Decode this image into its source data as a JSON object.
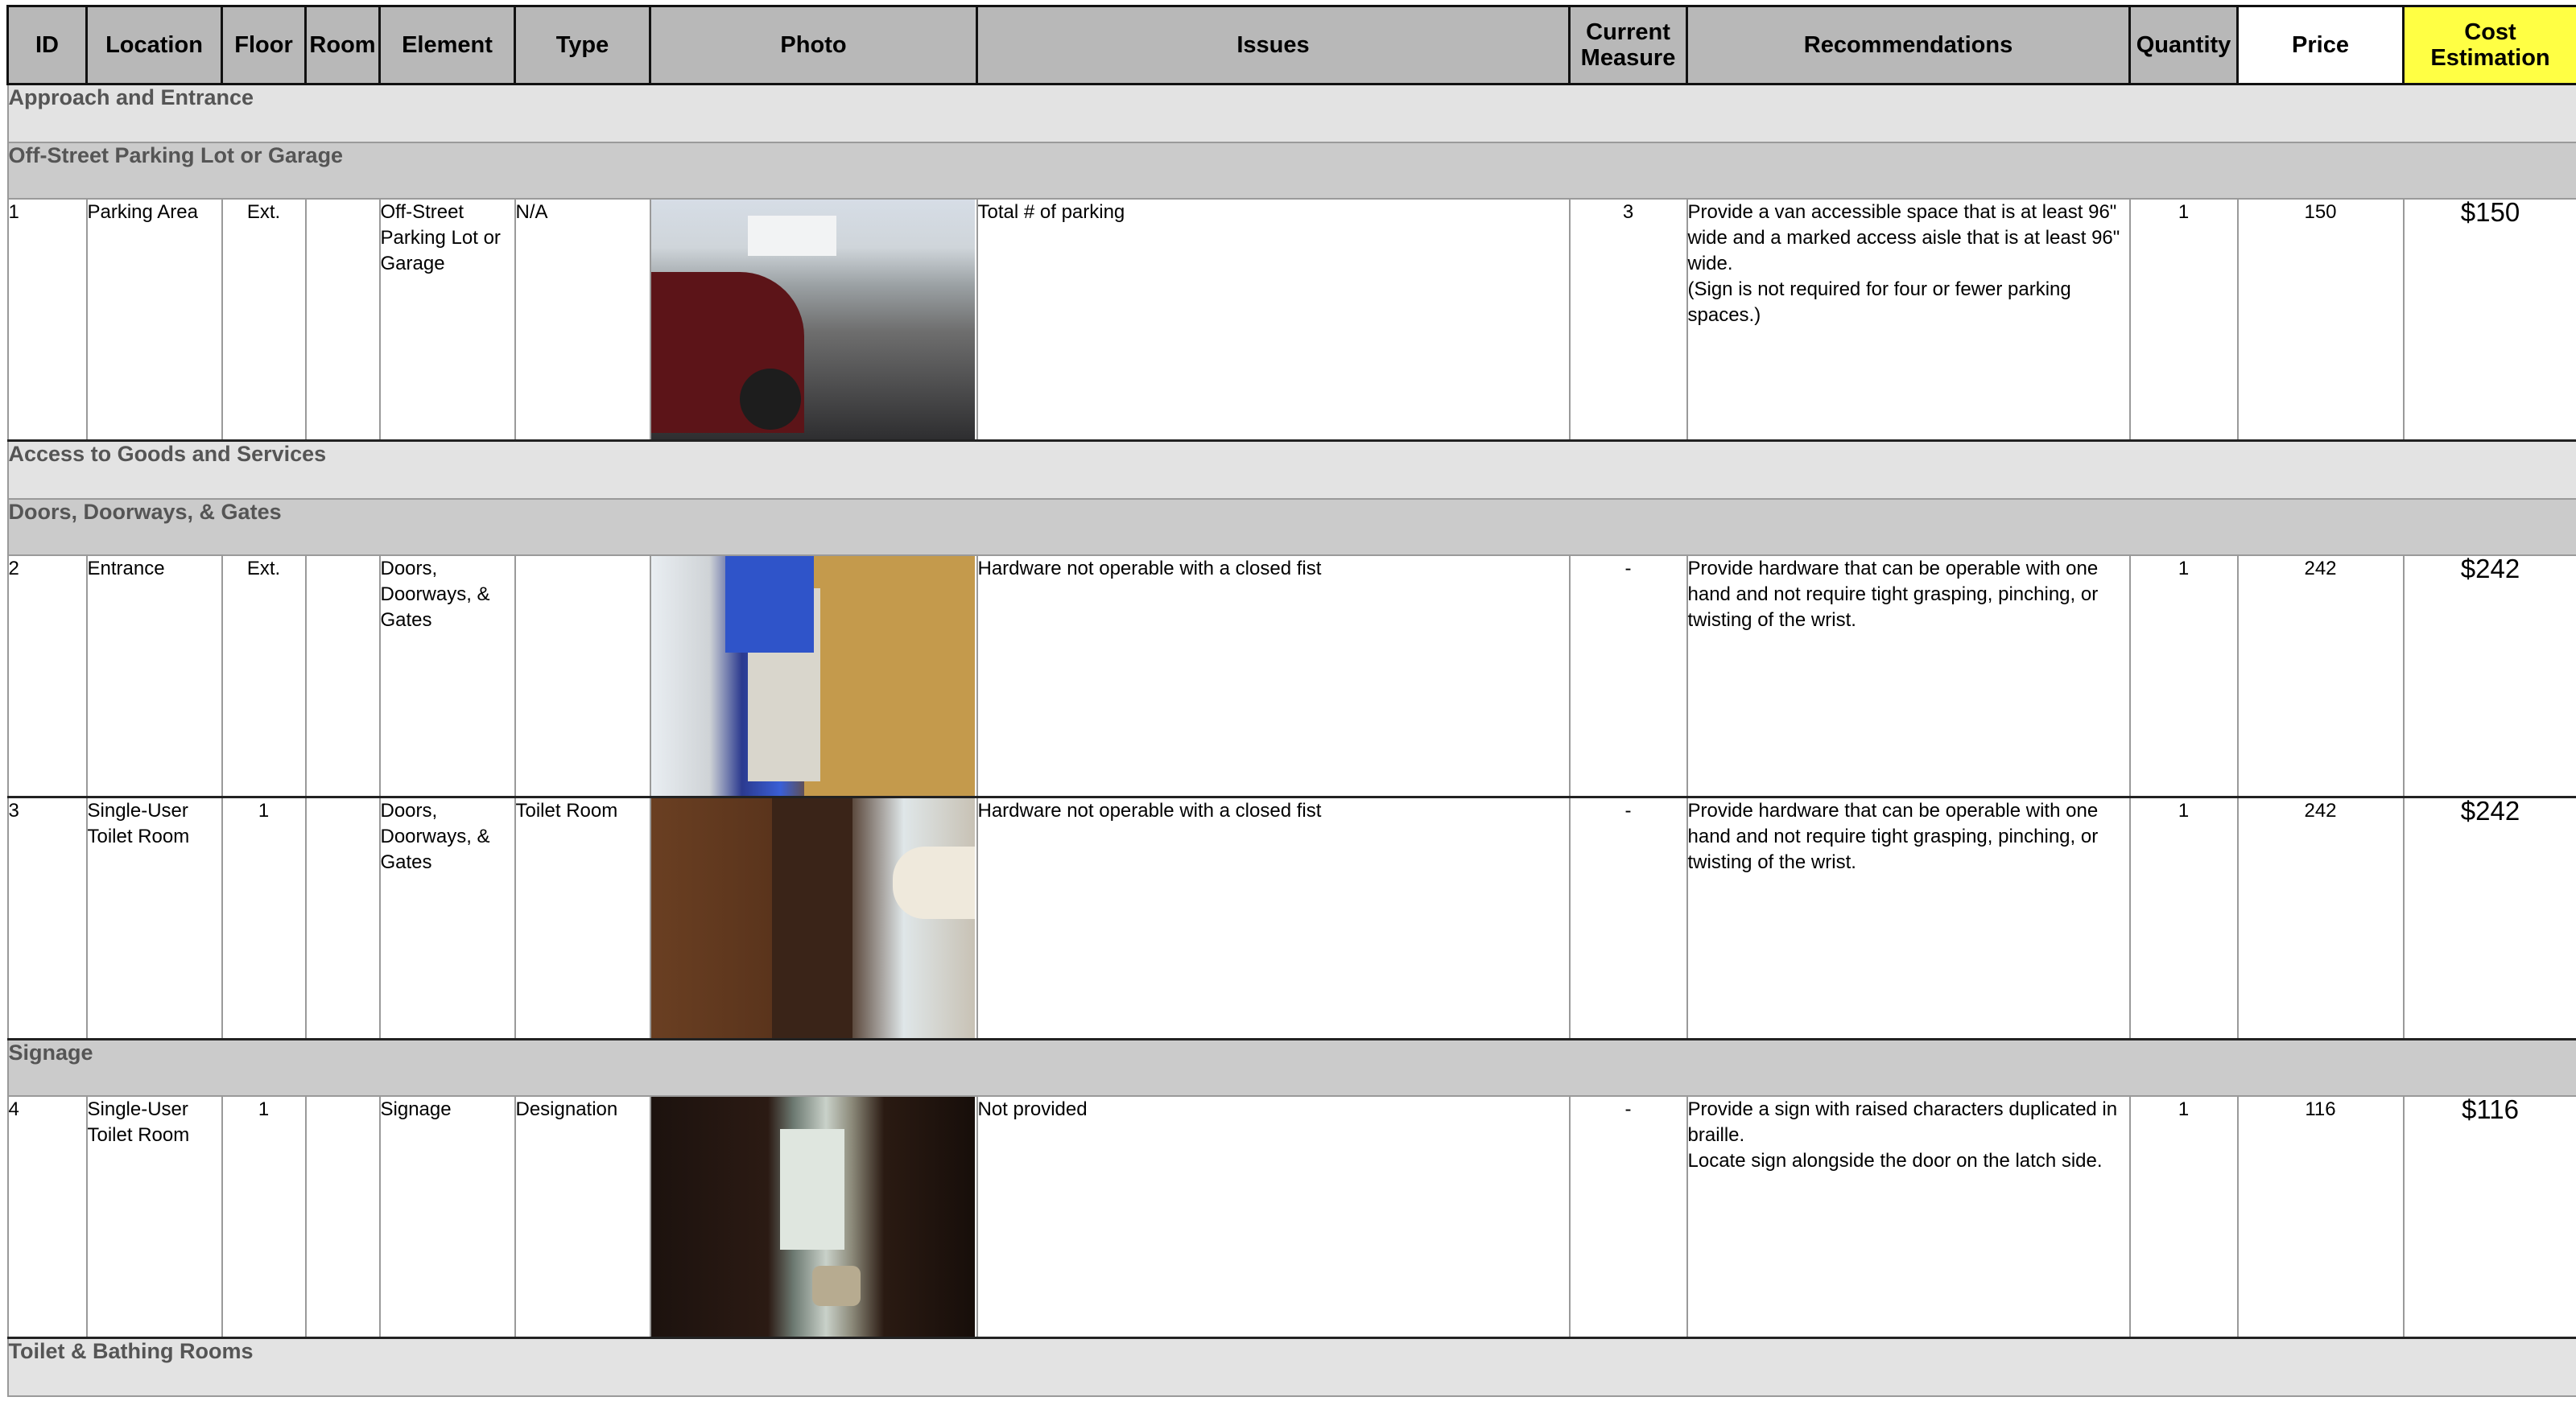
{
  "columns": {
    "id": "ID",
    "location": "Location",
    "floor": "Floor",
    "room": "Room",
    "element": "Element",
    "type": "Type",
    "photo": "Photo",
    "issues": "Issues",
    "current_measure": "Current Measure",
    "recommendations": "Recommendations",
    "quantity": "Quantity",
    "price": "Price",
    "cost_estimation": "Cost Estimation"
  },
  "colors": {
    "cost_header": "#ffff44",
    "header": "#b8b8b8",
    "section": "#e3e3e3",
    "subsection": "#cbcbcb"
  },
  "sections": [
    {
      "title": "Approach and Entrance"
    },
    {
      "title": "Access to Goods and Services"
    },
    {
      "title": "Toilet & Bathing Rooms"
    }
  ],
  "subsections": [
    {
      "title": "Off-Street Parking Lot or Garage"
    },
    {
      "title": "Doors, Doorways, & Gates"
    },
    {
      "title": "Signage"
    }
  ],
  "items": [
    {
      "id": "1",
      "location": "Parking Area",
      "floor": "Ext.",
      "room": "",
      "element": "Off-Street Parking Lot or Garage",
      "type": "N/A",
      "photo": "photo-parking-area",
      "issue": "Total # of parking",
      "current_measure": "3",
      "recommendation": "Provide a van accessible space that is at least 96\" wide and a marked access aisle that is at least 96\" wide.\n(Sign is not required for four or fewer parking spaces.)",
      "quantity": "1",
      "price": "150",
      "cost": "$150"
    },
    {
      "id": "2",
      "location": "Entrance",
      "floor": "Ext.",
      "room": "",
      "element": "Doors, Doorways, & Gates",
      "type": "",
      "photo": "photo-entrance-door",
      "issue": "Hardware not operable with a closed fist",
      "current_measure": "-",
      "recommendation": "Provide hardware that can be operable with one hand and not require tight grasping, pinching, or twisting of the wrist.",
      "quantity": "1",
      "price": "242",
      "cost": "$242"
    },
    {
      "id": "3",
      "location": "Single-User Toilet Room",
      "floor": "1",
      "room": "",
      "element": "Doors, Doorways, & Gates",
      "type": "Toilet Room",
      "photo": "photo-toilet-room-door",
      "issue": "Hardware not operable with a closed fist",
      "current_measure": "-",
      "recommendation": "Provide hardware that can be operable with one hand and not require tight grasping, pinching, or twisting of the wrist.",
      "quantity": "1",
      "price": "242",
      "cost": "$242"
    },
    {
      "id": "4",
      "location": "Single-User Toilet Room",
      "floor": "1",
      "room": "",
      "element": "Signage",
      "type": "Designation",
      "photo": "photo-toilet-room-signage",
      "issue": "Not provided",
      "current_measure": "-",
      "recommendation": "Provide a sign with raised characters duplicated in braille.\nLocate sign alongside the door on the latch side.",
      "quantity": "1",
      "price": "116",
      "cost": "$116"
    }
  ]
}
